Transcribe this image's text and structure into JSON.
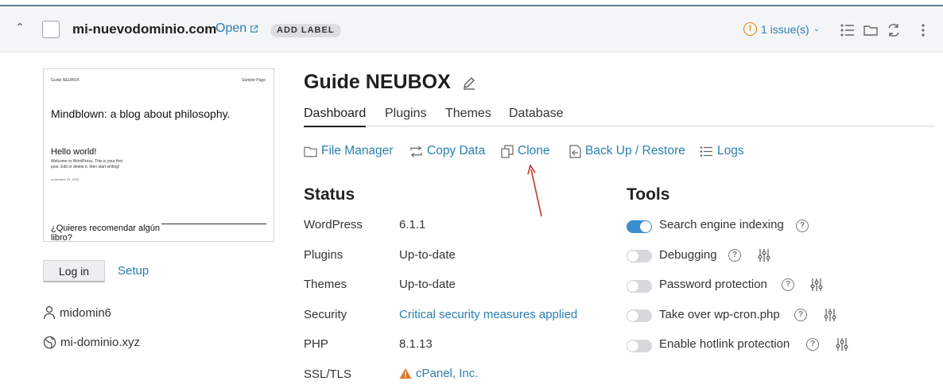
{
  "header": {
    "domain": "mi-nuevodominio.com",
    "open_label": "Open",
    "add_label": "ADD LABEL",
    "issues_label": "1 issue(s)"
  },
  "preview": {
    "site_name": "Guide NEUBOX",
    "sample_page": "Sample Page",
    "tagline": "Mindblown: a blog about philosophy.",
    "post_title": "Hello world!",
    "post_body": "Welcome to WordPress. This is your first post. Edit or delete it, then start writing!",
    "post_date": "noviembre 25, 2022",
    "question": "¿Quieres recomendar algún libro?"
  },
  "left": {
    "login_label": "Log in",
    "setup_label": "Setup",
    "user": "midomin6",
    "site_domain": "mi-dominio.xyz"
  },
  "main": {
    "title": "Guide NEUBOX",
    "tabs": [
      {
        "label": "Dashboard"
      },
      {
        "label": "Plugins"
      },
      {
        "label": "Themes"
      },
      {
        "label": "Database"
      }
    ],
    "actions": [
      {
        "label": "File Manager",
        "icon": "folder-icon"
      },
      {
        "label": "Copy Data",
        "icon": "copy-arrows-icon"
      },
      {
        "label": "Clone",
        "icon": "clone-icon"
      },
      {
        "label": "Back Up / Restore",
        "icon": "backup-icon"
      },
      {
        "label": "Logs",
        "icon": "list-icon"
      }
    ]
  },
  "status": {
    "heading": "Status",
    "rows": [
      {
        "label": "WordPress",
        "value": "6.1.1"
      },
      {
        "label": "Plugins",
        "value": "Up-to-date"
      },
      {
        "label": "Themes",
        "value": "Up-to-date"
      },
      {
        "label": "Security",
        "value": "Critical security measures applied"
      },
      {
        "label": "PHP",
        "value": "8.1.13"
      },
      {
        "label": "SSL/TLS",
        "value": "cPanel, Inc."
      }
    ]
  },
  "tools": {
    "heading": "Tools",
    "items": [
      {
        "label": "Search engine indexing",
        "enabled": true
      },
      {
        "label": "Debugging",
        "enabled": false
      },
      {
        "label": "Password protection",
        "enabled": false
      },
      {
        "label": "Take over wp-cron.php",
        "enabled": false
      },
      {
        "label": "Enable hotlink protection",
        "enabled": false
      }
    ]
  },
  "colors": {
    "link": "#2a7fb0",
    "toggle_on": "#3b8fd0",
    "warning": "#e08a00",
    "annotation_arrow": "#c0392b"
  }
}
